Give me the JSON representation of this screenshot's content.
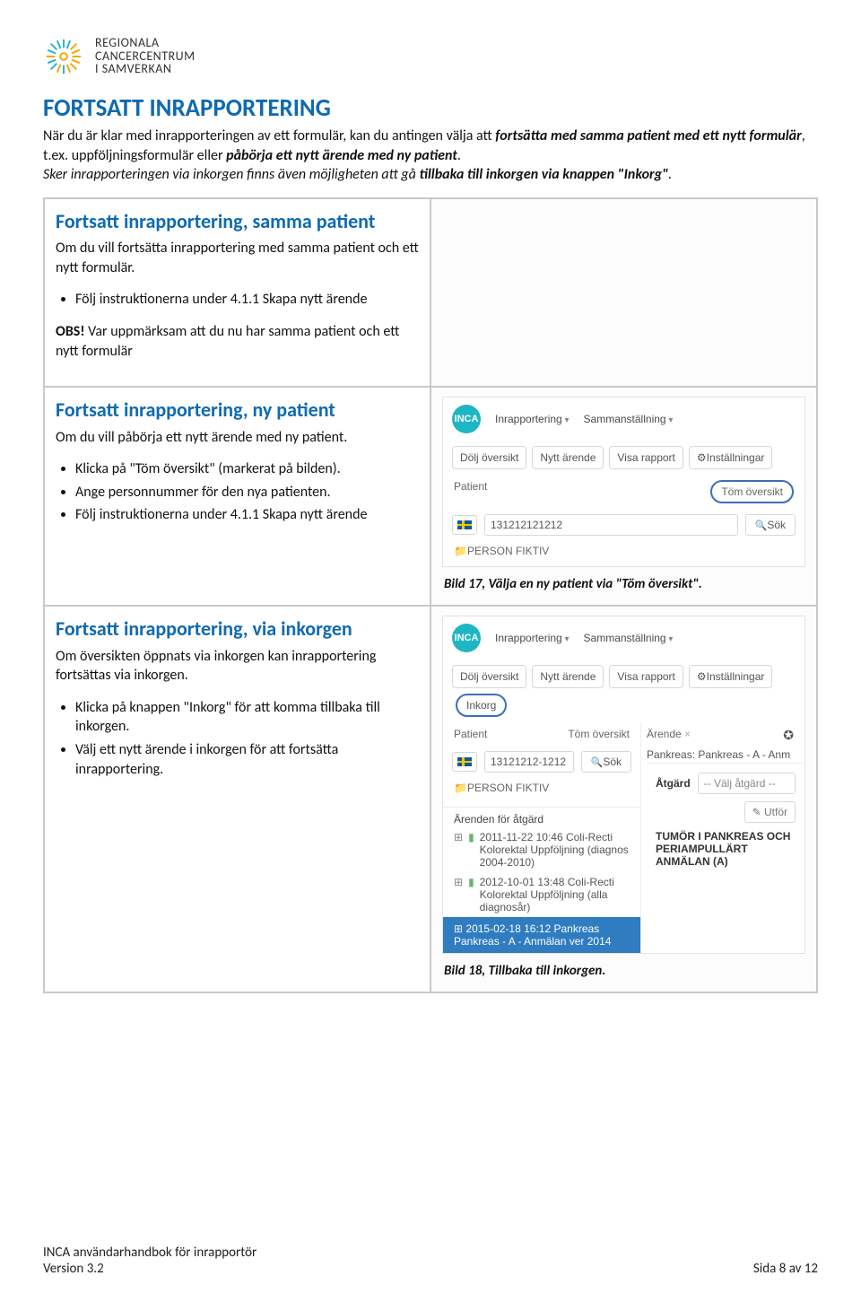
{
  "logo": {
    "line1": "REGIONALA",
    "line2": "CANCERCENTRUM",
    "line3": "I SAMVERKAN"
  },
  "title": "FORTSATT INRAPPORTERING",
  "intro": {
    "p1a": "När du är klar med inrapporteringen av ett formulär, kan du antingen välja att ",
    "p1b": "fortsätta med samma patient med ett nytt formulär",
    "p1c": ", t.ex. uppföljningsformulär eller ",
    "p1d": "påbörja ett nytt ärende med ny patient",
    "p1e": ".",
    "p2a": "Sker inrapporteringen via inkorgen finns även möjligheten att gå ",
    "p2b": "tillbaka till inkorgen via knappen \"Inkorg\"",
    "p2c": "."
  },
  "row1": {
    "heading": "Fortsatt inrapportering, samma patient",
    "body": "Om du vill fortsätta inrapportering med samma patient och ett nytt formulär.",
    "bullet1": "Följ instruktionerna under 4.1.1 Skapa nytt ärende",
    "obs_label": "OBS!",
    "obs_text": " Var uppmärksam att du nu har samma patient och ett nytt formulär"
  },
  "row2": {
    "heading": "Fortsatt inrapportering, ny patient",
    "body": "Om du vill påbörja ett nytt ärende med ny patient.",
    "b1": "Klicka på \"Töm översikt\" (markerat på bilden).",
    "b2": "Ange personnummer för den nya patienten.",
    "b3": "Följ instruktionerna under 4.1.1 Skapa nytt ärende",
    "caption": "Bild 17, Välja en ny patient via \"Töm översikt\"."
  },
  "row3": {
    "heading": "Fortsatt inrapportering, via inkorgen",
    "body": "Om översikten öppnats via inkorgen kan inrapportering fortsättas via inkorgen.",
    "b1": "Klicka på knappen \"Inkorg\" för att komma tillbaka till inkorgen.",
    "b2": "Välj ett nytt ärende i inkorgen för att fortsätta inrapportering.",
    "caption": "Bild 18, Tillbaka till inkorgen."
  },
  "mini": {
    "badge": "INCA",
    "nav1": "Inrapportering",
    "nav2": "Sammanställning",
    "btn_dolj": "Dölj översikt",
    "btn_nytt": "Nytt ärende",
    "btn_visa": "Visa rapport",
    "btn_inst": "Inställningar",
    "btn_inkorg": "Inkorg",
    "lbl_patient": "Patient",
    "lbl_tom": "Töm översikt",
    "lbl_arende": "Ärende",
    "pnr1": "131212121212",
    "pnr2": "13121212-1212",
    "sok": "Sök",
    "folder": "PERSON FIKTIV",
    "arenden_head": "Ärenden för åtgärd",
    "item1": "2011-11-22 10:46 Coli-Recti Kolorektal Uppföljning (diagnos 2004-2010)",
    "item2": "2012-10-01 13:48 Coli-Recti Kolorektal Uppföljning (alla diagnosår)",
    "item3": "2015-02-18 16:12 Pankreas Pankreas - A - Anmälan ver 2014",
    "rp_crumb": "Pankreas: Pankreas - A - Anm",
    "rp_atgard": "Åtgärd",
    "rp_select": "-- Välj åtgärd --",
    "rp_utfor": "Utför",
    "rp_tumor": "TUMÖR I PANKREAS OCH PERIAMPULLÄRT\nANMÄLAN (A)"
  },
  "footer": {
    "left1": "INCA användarhandbok för inrapportör",
    "left2": "Version 3.2",
    "right": "Sida 8 av 12"
  }
}
